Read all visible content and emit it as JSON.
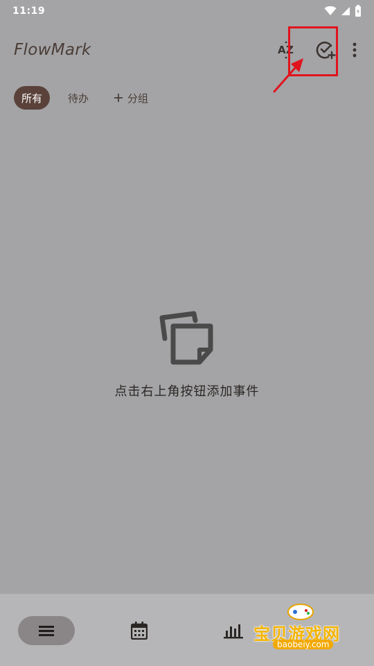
{
  "status_bar": {
    "time": "11:19"
  },
  "app_bar": {
    "title": "FlowMark",
    "actions": [
      {
        "name": "sort-az",
        "icon": "sort-az-icon"
      },
      {
        "name": "add-event",
        "icon": "check-add-icon"
      },
      {
        "name": "more",
        "icon": "more-vert-icon"
      }
    ]
  },
  "tabs": [
    {
      "label": "所有",
      "active": true
    },
    {
      "label": "待办",
      "active": false
    },
    {
      "label": "分组",
      "icon": "plus-icon",
      "active": false
    }
  ],
  "empty_state": {
    "icon": "sticky-notes-icon",
    "message": "点击右上角按钮添加事件"
  },
  "bottom_nav": [
    {
      "name": "list",
      "icon": "list-icon",
      "selected": true
    },
    {
      "name": "calendar",
      "icon": "calendar-icon",
      "selected": false
    },
    {
      "name": "stats",
      "icon": "bar-chart-icon",
      "selected": false
    }
  ],
  "watermark": {
    "text": "宝贝游戏网",
    "url": "baobeiy.com"
  },
  "colors": {
    "background": "#a4a4a6",
    "accent": "#5a423a",
    "highlight": "#e0141e"
  }
}
